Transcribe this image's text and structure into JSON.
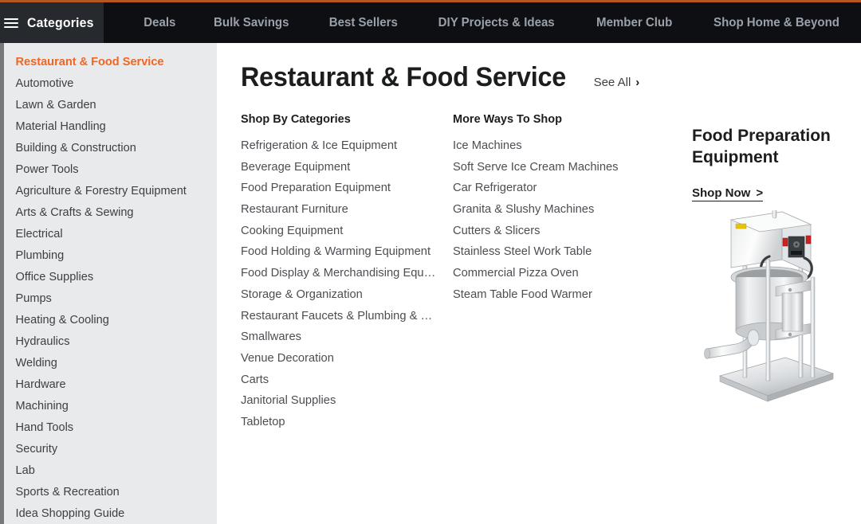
{
  "header": {
    "categories_button": {
      "label": "Categories",
      "icon": "hamburger-menu-icon"
    },
    "nav_items": [
      {
        "label": "Deals"
      },
      {
        "label": "Bulk Savings"
      },
      {
        "label": "Best Sellers"
      },
      {
        "label": "DIY Projects & Ideas"
      },
      {
        "label": "Member Club"
      },
      {
        "label": "Shop Home & Beyond"
      }
    ]
  },
  "sidebar": {
    "items": [
      {
        "label": "Restaurant & Food Service",
        "active": true
      },
      {
        "label": "Automotive",
        "active": false
      },
      {
        "label": "Lawn & Garden",
        "active": false
      },
      {
        "label": "Material Handling",
        "active": false
      },
      {
        "label": "Building & Construction",
        "active": false
      },
      {
        "label": "Power Tools",
        "active": false
      },
      {
        "label": "Agriculture & Forestry Equipment",
        "active": false
      },
      {
        "label": "Arts & Crafts & Sewing",
        "active": false
      },
      {
        "label": "Electrical",
        "active": false
      },
      {
        "label": "Plumbing",
        "active": false
      },
      {
        "label": "Office Supplies",
        "active": false
      },
      {
        "label": "Pumps",
        "active": false
      },
      {
        "label": "Heating & Cooling",
        "active": false
      },
      {
        "label": "Hydraulics",
        "active": false
      },
      {
        "label": "Welding",
        "active": false
      },
      {
        "label": "Hardware",
        "active": false
      },
      {
        "label": "Machining",
        "active": false
      },
      {
        "label": "Hand Tools",
        "active": false
      },
      {
        "label": "Security",
        "active": false
      },
      {
        "label": "Lab",
        "active": false
      },
      {
        "label": "Sports & Recreation",
        "active": false
      },
      {
        "label": "Idea Shopping Guide",
        "active": false
      }
    ]
  },
  "main": {
    "title": "Restaurant & Food Service",
    "see_all": {
      "label": "See All",
      "chevron": "›"
    },
    "columns": [
      {
        "heading": "Shop By Categories",
        "links": [
          "Refrigeration & Ice Equipment",
          "Beverage Equipment",
          "Food Preparation Equipment",
          "Restaurant Furniture",
          "Cooking Equipment",
          "Food Holding & Warming Equipment",
          "Food Display & Merchandising Equip…",
          "Storage & Organization",
          "Restaurant Faucets & Plumbing & Sinks",
          "Smallwares",
          "Venue Decoration",
          "Carts",
          "Janitorial Supplies",
          "Tabletop"
        ]
      },
      {
        "heading": "More Ways To Shop",
        "links": [
          "Ice Machines",
          "Soft Serve Ice Cream Machines",
          "Car Refrigerator",
          "Granita & Slushy Machines",
          "Cutters & Slicers",
          "Stainless Steel Work Table",
          "Commercial Pizza Oven",
          "Steam Table Food Warmer"
        ]
      }
    ],
    "promo": {
      "title": "Food Preparation Equipment",
      "cta_label": "Shop Now",
      "cta_chevron": ">",
      "image_alt": "stainless-steel-sausage-stuffer"
    }
  },
  "colors": {
    "header_bg": "#0d0f12",
    "categories_btn_bg": "#26292d",
    "top_strip": "#b4581f",
    "accent_orange": "#f26522",
    "sidebar_bg": "#e8eaec",
    "nav_text": "#9aa1ab",
    "scrollbar": "#76797c"
  }
}
